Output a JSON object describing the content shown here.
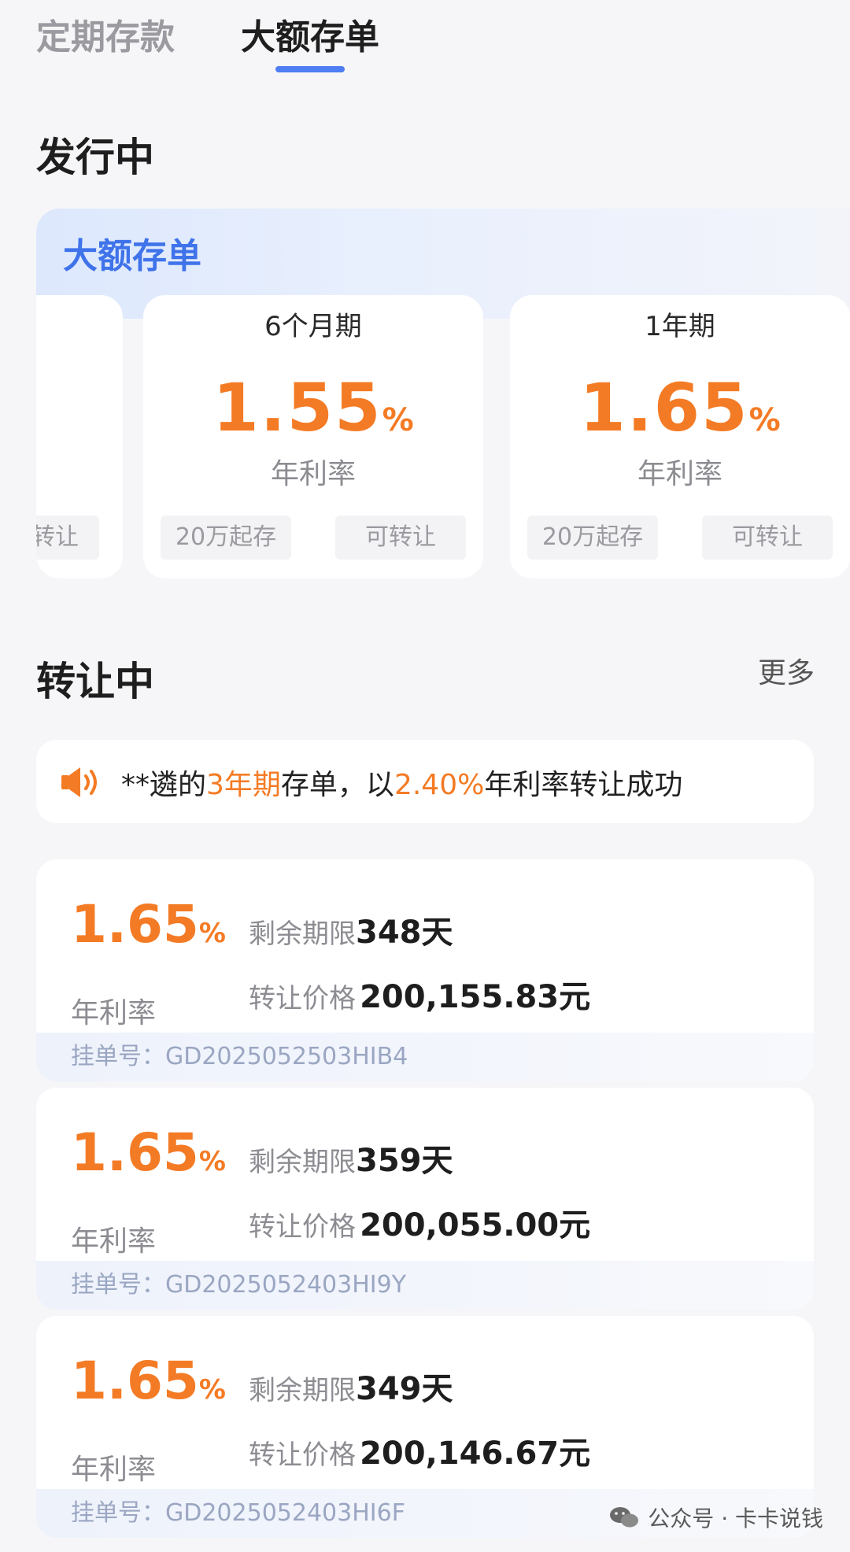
{
  "tabs": [
    {
      "label": "定期存款",
      "active": false
    },
    {
      "label": "大额存单",
      "active": true
    }
  ],
  "issuing": {
    "title": "发行中",
    "panel_label": "大额存单",
    "partial_chip": "转让",
    "products": [
      {
        "term": "6个月期",
        "rate": "1.55",
        "unit": "%",
        "rate_label": "年利率",
        "min": "20万起存",
        "transfer": "可转让"
      },
      {
        "term": "1年期",
        "rate": "1.65",
        "unit": "%",
        "rate_label": "年利率",
        "min": "20万起存",
        "transfer": "可转让"
      }
    ]
  },
  "transferring": {
    "title": "转让中",
    "more": "更多",
    "notice": {
      "icon": "speaker-icon",
      "prefix": "**遴的",
      "term": "3年期",
      "middle": "存单，以",
      "rate": "2.40%",
      "suffix": "年利率转让成功"
    },
    "listings": [
      {
        "rate": "1.65",
        "unit": "%",
        "rate_label": "年利率",
        "remain_key": "剩余期限",
        "remain_val": "348天",
        "price_key": "转让价格",
        "price_val": "200,155.83元",
        "order": "挂单号：GD2025052503HIB4"
      },
      {
        "rate": "1.65",
        "unit": "%",
        "rate_label": "年利率",
        "remain_key": "剩余期限",
        "remain_val": "359天",
        "price_key": "转让价格",
        "price_val": "200,055.00元",
        "order": "挂单号：GD2025052403HI9Y"
      },
      {
        "rate": "1.65",
        "unit": "%",
        "rate_label": "年利率",
        "remain_key": "剩余期限",
        "remain_val": "349天",
        "price_key": "转让价格",
        "price_val": "200,146.67元",
        "order": "挂单号：GD2025052403HI6F"
      }
    ]
  },
  "watermark": {
    "text": "公众号 · 卡卡说钱",
    "icon": "wechat-icon"
  },
  "colors": {
    "accent_orange": "#f47b25",
    "accent_blue": "#4f7df3",
    "background": "#f6f6f8"
  }
}
